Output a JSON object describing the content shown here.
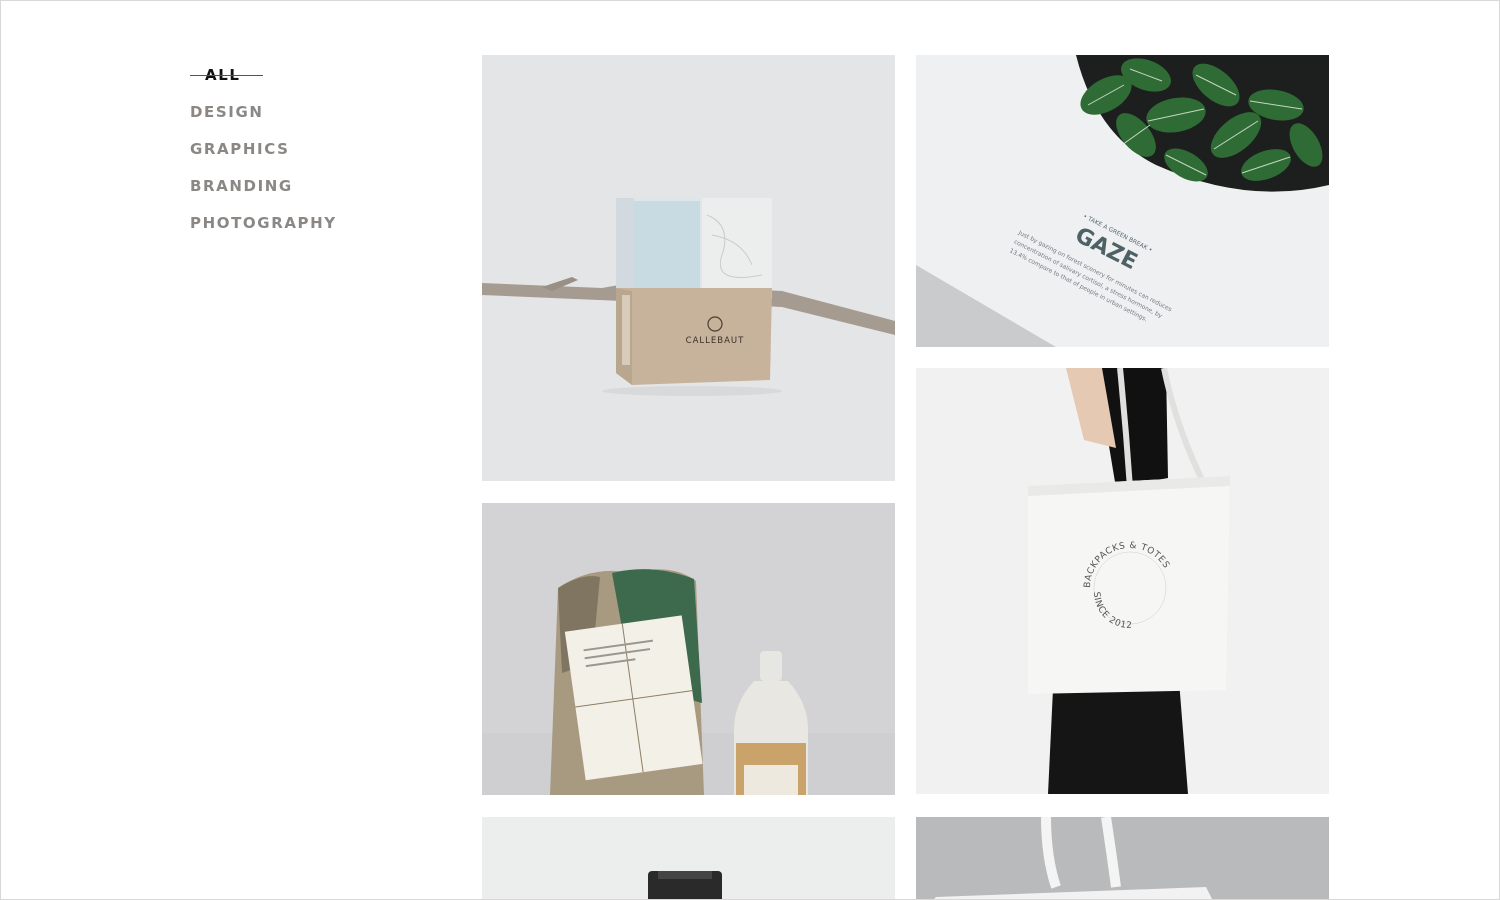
{
  "filters": [
    {
      "label": "ALL",
      "active": true
    },
    {
      "label": "DESIGN",
      "active": false
    },
    {
      "label": "GRAPHICS",
      "active": false
    },
    {
      "label": "BRANDING",
      "active": false
    },
    {
      "label": "PHOTOGRAPHY",
      "active": false
    }
  ],
  "portfolio": {
    "item1": {
      "brand": "CALLEBAUT"
    },
    "item2": {
      "tagline": "• TAKE A GREEN BREAK •",
      "title": "GAZE",
      "body1": "Just by gazing on forest scenery for minutes can reduces",
      "body2": "concentration of salivary cortisol, a stress hormone, by",
      "body3": "13.4% compare to that of people in urban settings."
    },
    "item4": {
      "ring_top": "BACKPACKS & TOTES",
      "ring_bottom": "SINCE 2012"
    }
  },
  "colors": {
    "accent": "#a0267a",
    "nav_text": "#8a8784",
    "active_text": "#111111"
  }
}
